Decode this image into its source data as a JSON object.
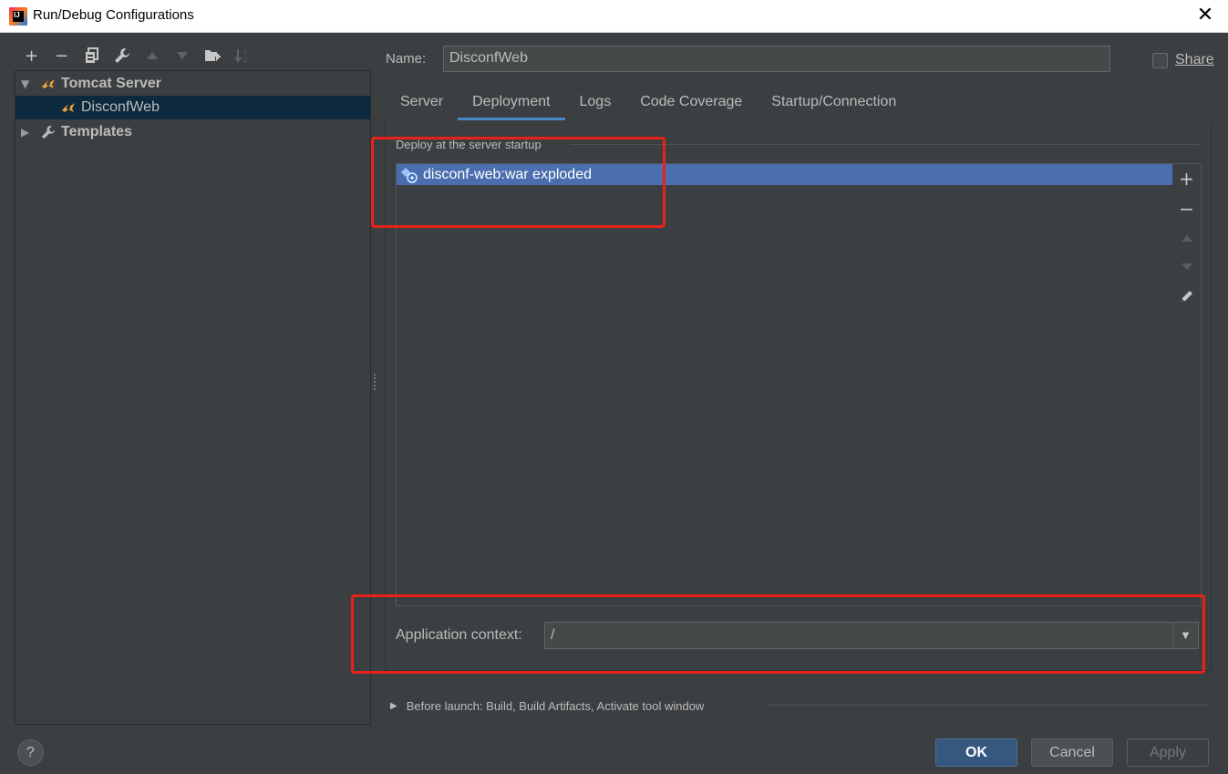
{
  "window": {
    "title": "Run/Debug Configurations",
    "close_glyph": "✕"
  },
  "toolbar": {
    "items": [
      {
        "name": "add-icon",
        "glyph": "+",
        "enabled": true
      },
      {
        "name": "remove-icon",
        "glyph": "−",
        "enabled": true
      },
      {
        "name": "copy-icon",
        "enabled": true
      },
      {
        "name": "wrench-icon",
        "enabled": true
      },
      {
        "name": "move-up-icon",
        "enabled": false
      },
      {
        "name": "move-down-icon",
        "enabled": false
      },
      {
        "name": "new-folder-icon",
        "enabled": true
      },
      {
        "name": "sort-icon",
        "enabled": false
      }
    ]
  },
  "tree": {
    "groups": [
      {
        "label": "Tomcat Server",
        "expanded": true,
        "icon": "tomcat-icon"
      },
      {
        "label": "DisconfWeb",
        "selected": true,
        "icon": "tomcat-icon"
      },
      {
        "label": "Templates",
        "expanded": false,
        "icon": "wrench-icon"
      }
    ]
  },
  "form": {
    "name_label": "Name:",
    "name_value": "DisconfWeb",
    "share_label": "Share",
    "share_checked": false
  },
  "tabs": [
    {
      "label": "Server",
      "active": false
    },
    {
      "label": "Deployment",
      "active": true
    },
    {
      "label": "Logs",
      "active": false
    },
    {
      "label": "Code Coverage",
      "active": false
    },
    {
      "label": "Startup/Connection",
      "active": false
    }
  ],
  "deployment": {
    "section_title": "Deploy at the server startup",
    "artifacts": [
      {
        "label": "disconf-web:war exploded",
        "icon": "artifact-icon",
        "selected": true
      }
    ],
    "context_label": "Application context:",
    "context_value": "/"
  },
  "before_launch": {
    "label": "Before launch: Build, Build Artifacts, Activate tool window"
  },
  "buttons": {
    "help": "?",
    "ok": "OK",
    "cancel": "Cancel",
    "apply": "Apply"
  },
  "colors": {
    "background": "#3c3f41",
    "selection": "#4b6eaf",
    "tree_selection": "#0d293e",
    "tab_underline": "#4a88c7",
    "highlight": "#e8221b",
    "ok_button": "#365880"
  }
}
